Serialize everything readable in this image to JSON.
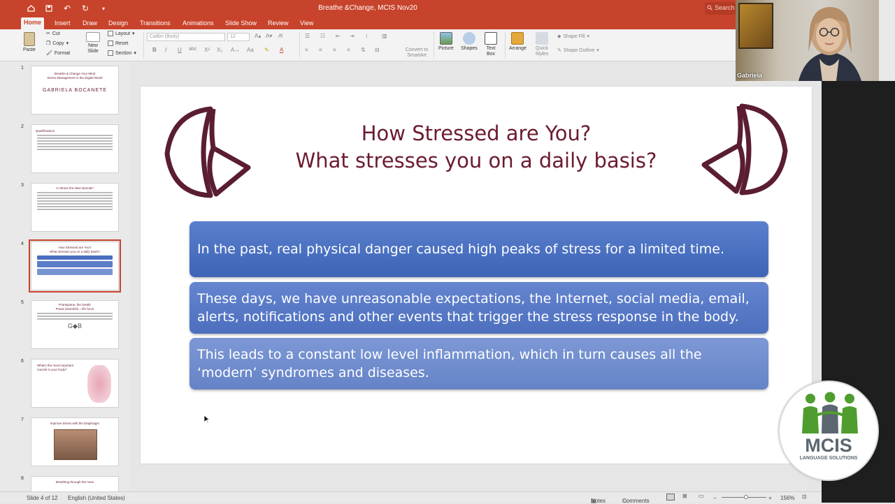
{
  "window": {
    "title": "Breathe &Change, MCIS Nov20",
    "search_placeholder": "Search"
  },
  "ribbon_tabs": [
    "Home",
    "Insert",
    "Draw",
    "Design",
    "Transitions",
    "Animations",
    "Slide Show",
    "Review",
    "View"
  ],
  "ribbon": {
    "paste": "Paste",
    "cut": "Cut",
    "copy": "Copy",
    "format": "Format",
    "new_slide": "New Slide",
    "layout": "Layout",
    "reset": "Reset",
    "section": "Section",
    "font_name": "Calibri (Body)",
    "font_size": "12",
    "convert_smartart": "Convert to SmartArt",
    "picture": "Picture",
    "shapes": "Shapes",
    "text_box": "Text Box",
    "arrange": "Arrange",
    "quick_styles": "Quick Styles",
    "shape_fill": "Shape Fill",
    "shape_outline": "Shape Outline"
  },
  "thumbnails": [
    {
      "num": "1",
      "title": "Breathe & Change Your Mind\nStress Management in the Digital World",
      "name": "GABRIELA BOCANETE"
    },
    {
      "num": "2",
      "title": "Qualifications"
    },
    {
      "num": "3",
      "title": "Is Stress the New Normal?"
    },
    {
      "num": "4",
      "title": "How Stressed are You?\nWhat stresses you on a daily basis?"
    },
    {
      "num": "5",
      "title": "Pranayama, the breath\nPrana (Sanskrit) = life force"
    },
    {
      "num": "6",
      "title": "What's the most important muscle in your body?"
    },
    {
      "num": "7",
      "title": "Improve Stress with the Diaphragm"
    },
    {
      "num": "8",
      "title": "Breathing through the nose"
    }
  ],
  "slide": {
    "title_line1": "How Stressed are You?",
    "title_line2": "What stresses you on a daily basis?",
    "boxes": [
      "In the past, real physical danger caused high peaks of stress for a limited time.",
      "These days, we have unreasonable expectations, the Internet, social media, email, alerts, notifications and other events that trigger the stress response in the body.",
      "This leads to a constant low level inflammation, which in turn causes all the ‘modern’ syndromes and diseases."
    ]
  },
  "status": {
    "slide_count": "Slide 4 of 12",
    "language": "English (United States)",
    "notes": "Notes",
    "comments": "Comments",
    "zoom": "156%"
  },
  "video": {
    "participant_name": "Gabriela"
  },
  "logo": {
    "text": "MCIS",
    "subtext": "LANGUAGE SOLUTIONS"
  },
  "colors": {
    "accent": "#c8432b",
    "title": "#6b1b2f",
    "box_blue": "#4a6fc0"
  }
}
